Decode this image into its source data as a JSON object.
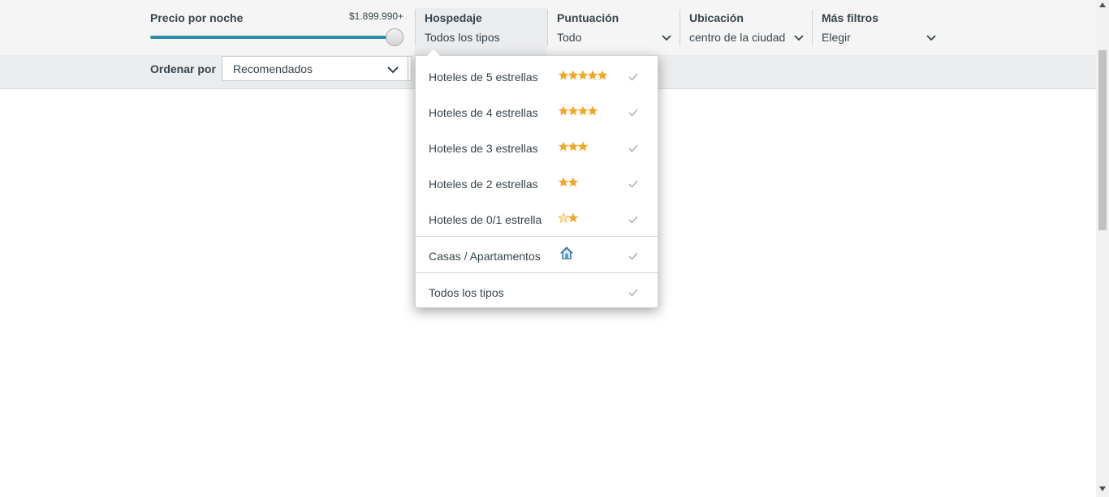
{
  "filters": {
    "price": {
      "title": "Precio por noche",
      "max_label": "$1.899.990+",
      "slider_level_percent": 100
    },
    "hospedaje": {
      "title": "Hospedaje",
      "value": "Todos los tipos"
    },
    "puntuacion": {
      "title": "Puntuación",
      "value": "Todo"
    },
    "ubicacion": {
      "title": "Ubicación",
      "value": "centro de la ciudad"
    },
    "mas_filtros": {
      "title": "Más filtros",
      "value": "Elegir"
    }
  },
  "sort": {
    "label": "Ordenar por",
    "value": "Recomendados"
  },
  "dropdown": {
    "options": [
      {
        "label": "Hoteles de 5 estrellas",
        "stars": 5,
        "icon": "star-icon"
      },
      {
        "label": "Hoteles de 4 estrellas",
        "stars": 4,
        "icon": "star-icon"
      },
      {
        "label": "Hoteles de 3 estrellas",
        "stars": 3,
        "icon": "star-icon"
      },
      {
        "label": "Hoteles de 2 estrellas",
        "stars": 2,
        "icon": "star-icon"
      },
      {
        "label": "Hoteles de 0/1 estrella",
        "stars": 1,
        "icon": "star-icon"
      },
      {
        "label": "Casas / Apartamentos",
        "icon": "house-icon"
      },
      {
        "label": "Todos los tipos",
        "icon": ""
      }
    ]
  },
  "colors": {
    "accent": "#2e8ca8",
    "star": "#f5a623",
    "house": "#4a90c2",
    "text": "#37454d",
    "check": "#b0b0b0"
  }
}
